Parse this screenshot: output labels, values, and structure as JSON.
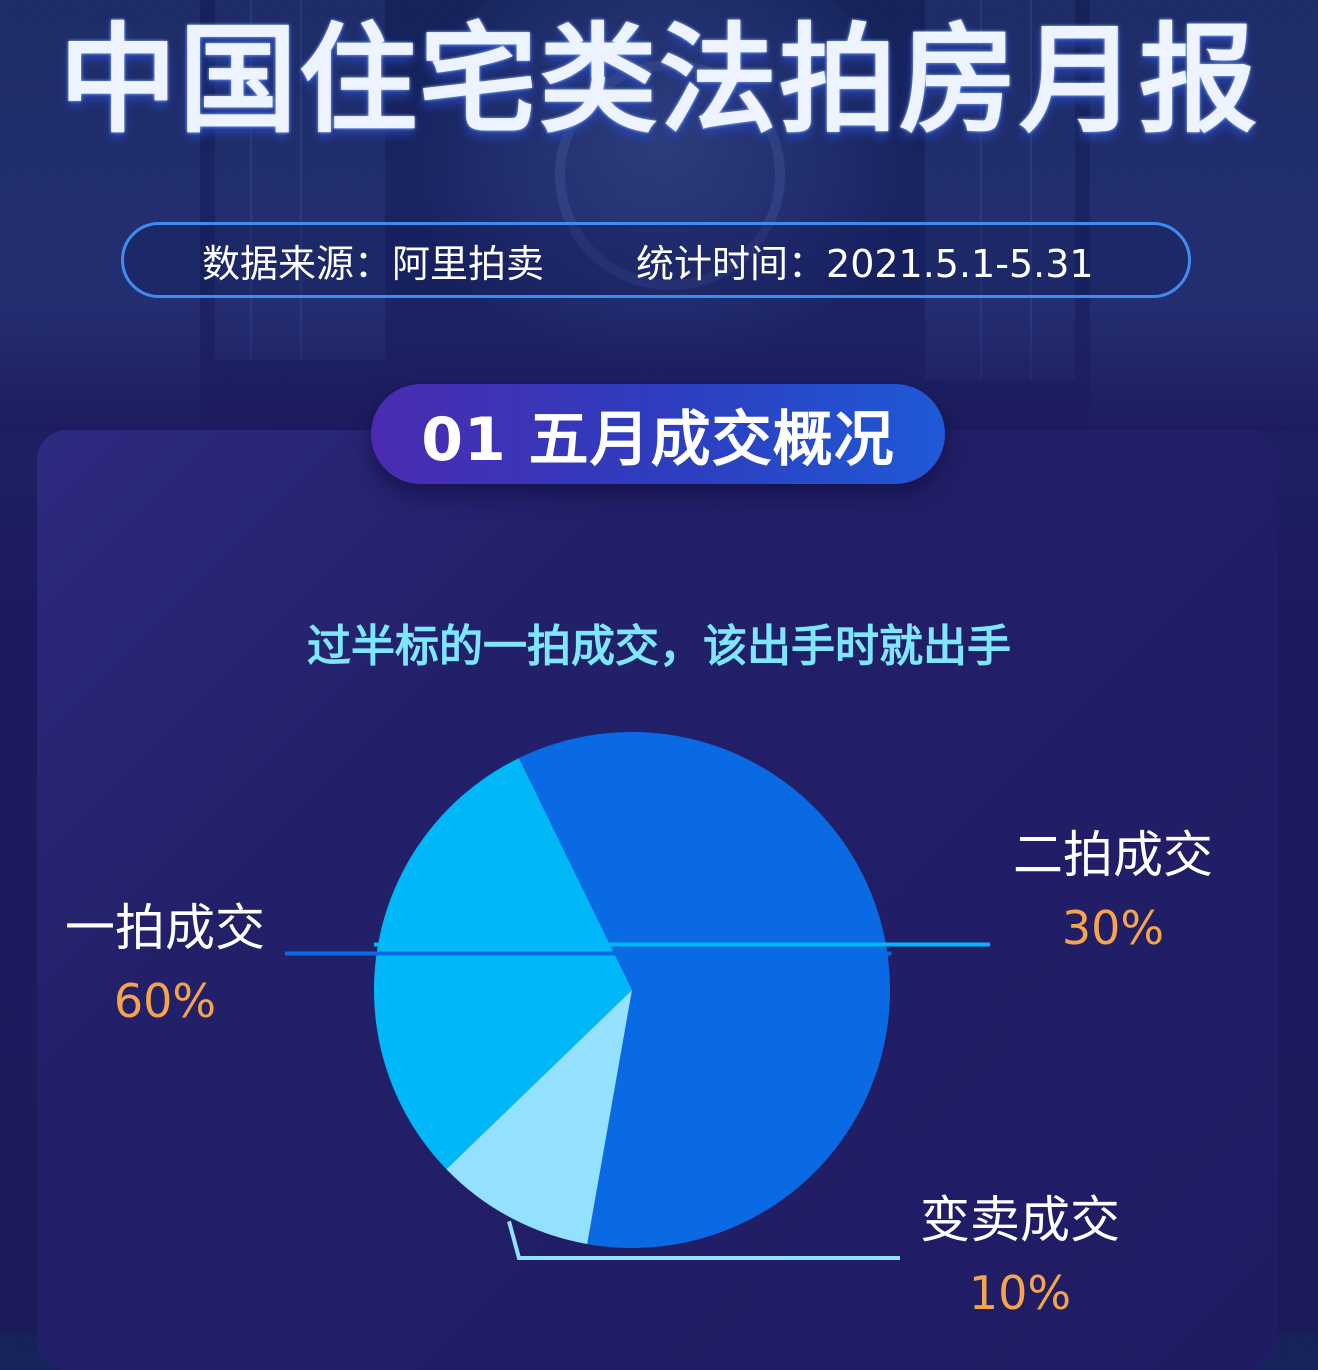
{
  "header": {
    "title": "中国住宅类法拍房月报",
    "source_label": "数据来源：",
    "source_value": "阿里拍卖",
    "period_label": "统计时间：",
    "period_value": "2021.5.1-5.31"
  },
  "section": {
    "badge": "01 五月成交概况",
    "headline": "过半标的一拍成交，该出手时就出手"
  },
  "colors": {
    "first_auction": "#0a6ae3",
    "second_auction": "#00b8f8",
    "sale_off": "#94e1ff",
    "percent_text": "#f5a34d",
    "headline_text": "#7fe6ff"
  },
  "chart_data": {
    "type": "pie",
    "title": "",
    "slices": [
      {
        "label": "一拍成交",
        "percent_label": "60%",
        "value": 60,
        "color": "#0a6ae3"
      },
      {
        "label": "二拍成交",
        "percent_label": "30%",
        "value": 30,
        "color": "#00b8f8"
      },
      {
        "label": "变卖成交",
        "percent_label": "10%",
        "value": 10,
        "color": "#94e1ff"
      }
    ]
  }
}
